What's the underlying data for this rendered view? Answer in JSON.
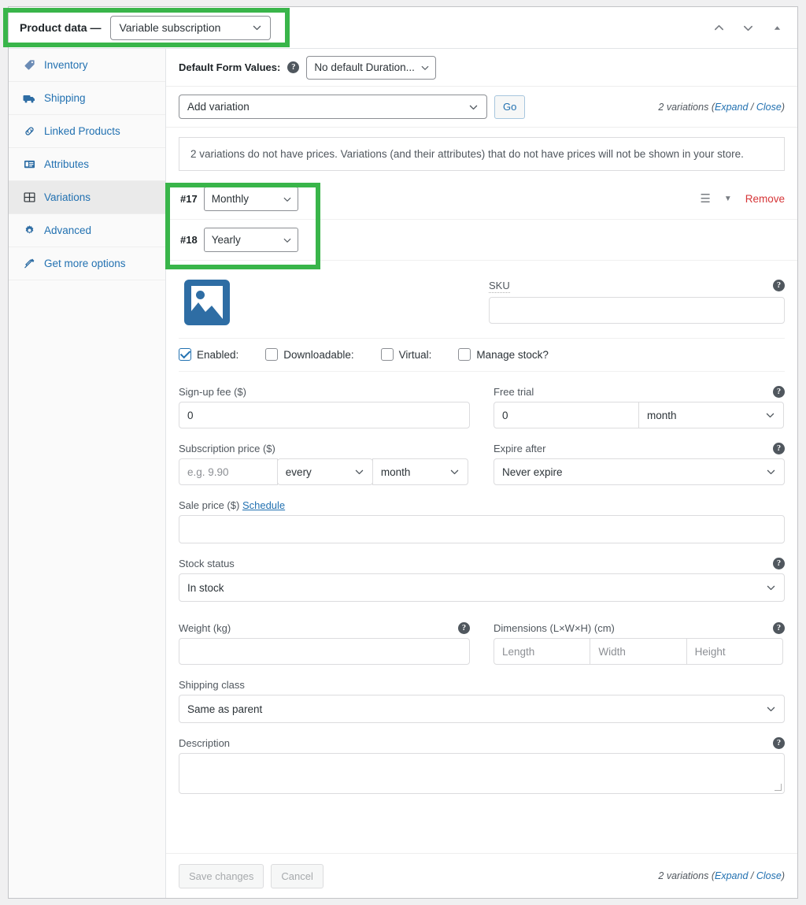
{
  "header": {
    "product_data_label": "Product data —",
    "product_type": "Variable subscription",
    "icons": [
      "chevron-up-icon",
      "chevron-down-icon",
      "toggle-panel-icon"
    ]
  },
  "sidebar": {
    "items": [
      {
        "label": "Inventory",
        "icon": "tag-icon",
        "active": false
      },
      {
        "label": "Shipping",
        "icon": "truck-icon",
        "active": false
      },
      {
        "label": "Linked Products",
        "icon": "link-icon",
        "active": false
      },
      {
        "label": "Attributes",
        "icon": "list-icon",
        "active": false
      },
      {
        "label": "Variations",
        "icon": "grid-icon",
        "active": true
      },
      {
        "label": "Advanced",
        "icon": "gear-icon",
        "active": false
      },
      {
        "label": "Get more options",
        "icon": "plugin-icon",
        "active": false
      }
    ]
  },
  "default_form_values": {
    "label": "Default Form Values:",
    "help": "?",
    "selected": "No default Duration..."
  },
  "toolbar": {
    "add_variation_selected": "Add variation",
    "go_label": "Go",
    "variations_count_text": "2 variations",
    "expand_label": "Expand",
    "separator": "/",
    "close_label": "Close"
  },
  "notice": {
    "text": "2 variations do not have prices. Variations (and their attributes) that do not have prices will not be shown in your store."
  },
  "variations": [
    {
      "number": "#17",
      "attribute": "Monthly"
    },
    {
      "number": "#18",
      "attribute": "Yearly"
    }
  ],
  "variation_actions": {
    "grip_icon": "drag-handle-icon",
    "expand_icon": "caret-down-icon",
    "remove_label": "Remove"
  },
  "detail": {
    "image_alt": "product-image-placeholder",
    "sku": {
      "label": "SKU",
      "value": "",
      "help": "?"
    },
    "checkboxes": [
      {
        "label": "Enabled:",
        "checked": true
      },
      {
        "label": "Downloadable:",
        "checked": false
      },
      {
        "label": "Virtual:",
        "checked": false
      },
      {
        "label": "Manage stock?",
        "checked": false
      }
    ],
    "signup_fee": {
      "label": "Sign-up fee ($)",
      "value": "0"
    },
    "free_trial": {
      "label": "Free trial",
      "value": "0",
      "period": "month",
      "help": "?"
    },
    "subscription_price": {
      "label": "Subscription price ($)",
      "placeholder": "e.g. 9.90",
      "interval": "every",
      "period": "month"
    },
    "expire_after": {
      "label": "Expire after",
      "value": "Never expire",
      "help": "?"
    },
    "sale_price": {
      "label": "Sale price ($)",
      "schedule_label": "Schedule",
      "value": ""
    },
    "stock_status": {
      "label": "Stock status",
      "value": "In stock",
      "help": "?"
    },
    "weight": {
      "label": "Weight (kg)",
      "value": "",
      "help": "?"
    },
    "dimensions": {
      "label": "Dimensions (L×W×H) (cm)",
      "help": "?",
      "length_placeholder": "Length",
      "width_placeholder": "Width",
      "height_placeholder": "Height"
    },
    "shipping_class": {
      "label": "Shipping class",
      "value": "Same as parent"
    },
    "description": {
      "label": "Description",
      "value": "",
      "help": "?"
    }
  },
  "footer": {
    "save_label": "Save changes",
    "cancel_label": "Cancel",
    "variations_count_text": "2 variations",
    "expand_label": "Expand",
    "separator": "/",
    "close_label": "Close"
  },
  "colors": {
    "highlight": "#39b54a",
    "link": "#2271b1",
    "danger": "#d63638",
    "accent_blue": "#2e6da4"
  }
}
